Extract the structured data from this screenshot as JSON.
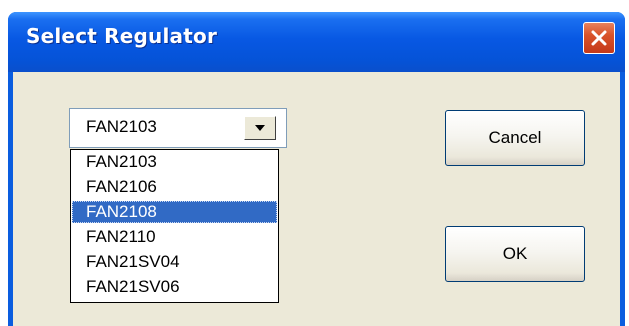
{
  "window": {
    "title": "Select Regulator"
  },
  "icons": {
    "close": "close-icon",
    "dropdown_arrow": "chevron-down-icon"
  },
  "colors": {
    "titlebar": "#0858e3",
    "client_background": "#ece9d8",
    "close_button": "#d9532a",
    "selection": "#316ac5"
  },
  "regulator_select": {
    "value": "FAN2103",
    "options": [
      "FAN2103",
      "FAN2106",
      "FAN2108",
      "FAN2110",
      "FAN21SV04",
      "FAN21SV06"
    ],
    "highlighted": "FAN2108"
  },
  "buttons": {
    "cancel_label": "Cancel",
    "ok_label": "OK"
  }
}
